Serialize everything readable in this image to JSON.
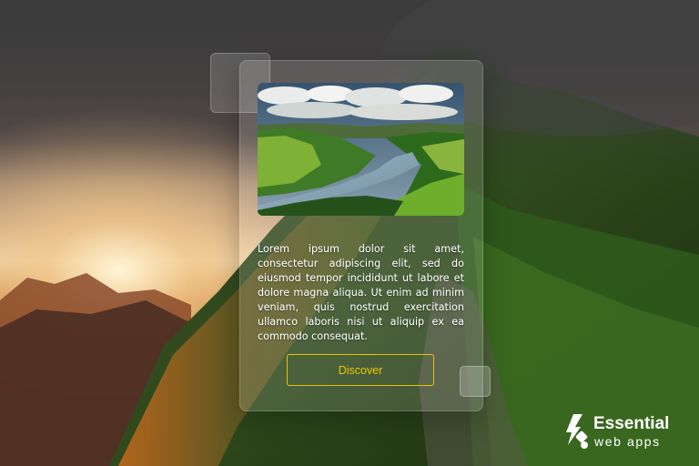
{
  "card": {
    "body_text": "Lorem ipsum dolor sit amet, consectetur adipiscing elit, sed do eiusmod tempor incididunt ut labore et dolore magna aliqua. Ut enim ad minim veniam, quis nostrud exercitation ullamco laboris nisi ut aliquip ex ea commodo consequat.",
    "button_label": "Discover",
    "image_icon": "landscape-photo"
  },
  "brand": {
    "title": "Essential",
    "subtitle": "web apps",
    "icon": "essential-web-apps-logo-icon"
  },
  "colors": {
    "button_accent": "#e8c200",
    "card_text": "#ffffff"
  }
}
